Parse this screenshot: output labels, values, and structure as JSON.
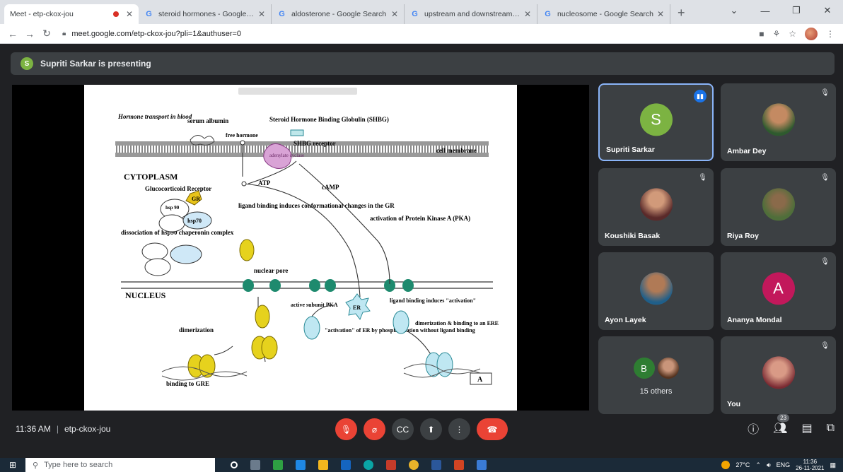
{
  "browser": {
    "tabs": [
      {
        "title": "Meet - etp-ckox-jou",
        "favicon": "meet",
        "recording": true,
        "active": true
      },
      {
        "title": "steroid hormones - Google Sear",
        "favicon": "google"
      },
      {
        "title": "aldosterone - Google Search",
        "favicon": "google"
      },
      {
        "title": "upstream and downstream dna",
        "favicon": "google"
      },
      {
        "title": "nucleosome - Google Search",
        "favicon": "google"
      }
    ],
    "url": "meet.google.com/etp-ckox-jou?pli=1&authuser=0"
  },
  "presenting_text": "Supriti Sarkar is presenting",
  "presenter_initial": "S",
  "slide": {
    "labels": {
      "hormone_transport": "Hormone transport in blood",
      "serum_albumin": "serum albumin",
      "free_hormone": "free hormone",
      "shbg": "Steroid Hormone Binding Globulin (SHBG)",
      "shbg_receptor": "SHBG receptor",
      "adenylate_cyclase": "adenylate cyclase",
      "cell_membrane": "cell membrane",
      "cytoplasm": "CYTOPLASM",
      "atp": "ATP",
      "camp": "cAMP",
      "glucocorticoid_receptor": "Glucocorticoid Receptor",
      "gr": "GR",
      "hsp90": "hsp 90",
      "hsp70": "hsp70",
      "ligand_binding": "ligand binding induces conformational changes in the GR",
      "dissociation": "dissociation of hsp90 chaperonin complex",
      "pka_activation": "activation of Protein Kinase A (PKA)",
      "nuclear_pore": "nuclear pore",
      "nucleus": "NUCLEUS",
      "active_pka": "active subunit PKA",
      "er": "ER",
      "ligand_binding_er": "ligand binding induces \"activation\"",
      "activation_er": "\"activation\" of ER by phosphorylation without ligand binding",
      "dimerization_er": "dimerization & binding to an ERE",
      "dimerization": "dimerization",
      "binding_gre": "binding to GRE",
      "panel": "A"
    }
  },
  "participants": [
    {
      "name": "Supriti Sarkar",
      "initial": "S",
      "avatar_color": "#7cb342",
      "speaking": true
    },
    {
      "name": "Ambar Dey",
      "photo": "avatar-photo",
      "muted": true
    },
    {
      "name": "Koushiki Basak",
      "photo": "avatar-photo",
      "muted": true
    },
    {
      "name": "Riya Roy",
      "photo": "avatar-photo",
      "muted": true
    },
    {
      "name": "Ayon Layek",
      "photo": "avatar-photo"
    },
    {
      "name": "Ananya Mondal",
      "initial": "A",
      "avatar_color": "#c2185b",
      "muted": true
    },
    {
      "others_label": "15 others",
      "others_initial": "B"
    },
    {
      "name": "You",
      "photo": "avatar-photo",
      "muted": true
    }
  ],
  "meeting": {
    "time": "11:36 AM",
    "code": "etp-ckox-jou",
    "people_count": "23"
  },
  "taskbar": {
    "search_placeholder": "Type here to search",
    "temperature": "27°C",
    "lang": "ENG",
    "time": "11:36",
    "date": "26-11-2021"
  }
}
